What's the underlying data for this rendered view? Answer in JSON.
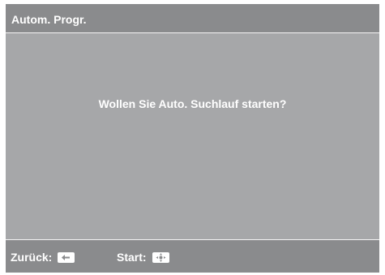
{
  "header": {
    "title": "Autom. Progr."
  },
  "dialog": {
    "question": "Wollen Sie Auto. Suchlauf starten?"
  },
  "footer": {
    "back_label": "Zurück:",
    "back_icon": "arrow-left-key-icon",
    "start_label": "Start:",
    "start_icon": "dpad-center-key-icon"
  },
  "colors": {
    "bar": "#8a8b8d",
    "panel": "#a6a7a9",
    "text": "#ffffff",
    "divider": "#f4f4f4"
  }
}
